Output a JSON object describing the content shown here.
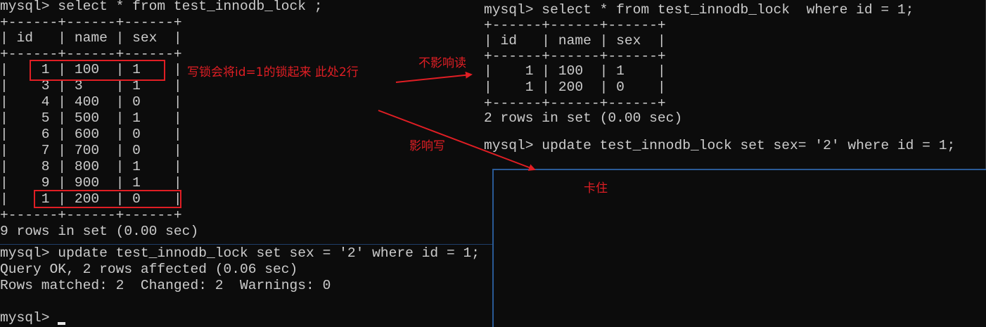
{
  "left_terminal": {
    "lines": [
      "mysql> select * from test_innodb_lock ;",
      "+------+------+------+",
      "| id   | name | sex  |",
      "+------+------+------+",
      "|    1 | 100  | 1    |",
      "|    3 | 3    | 1    |",
      "|    4 | 400  | 0    |",
      "|    5 | 500  | 1    |",
      "|    6 | 600  | 0    |",
      "|    7 | 700  | 0    |",
      "|    8 | 800  | 1    |",
      "|    9 | 900  | 1    |",
      "|    1 | 200  | 0    |",
      "+------+------+------+",
      "9 rows in set (0.00 sec)"
    ],
    "bottom_lines": [
      "mysql> update test_innodb_lock set sex = '2' where id = 1;",
      "Query OK, 2 rows affected (0.06 sec)",
      "Rows matched: 2  Changed: 2  Warnings: 0",
      ""
    ],
    "prompt": "mysql> "
  },
  "right_terminal": {
    "lines": [
      "mysql> select * from test_innodb_lock  where id = 1;",
      "+------+------+------+",
      "| id   | name | sex  |",
      "+------+------+------+",
      "|    1 | 100  | 1    |",
      "|    1 | 200  | 0    |",
      "+------+------+------+",
      "2 rows in set (0.00 sec)",
      "",
      "mysql> update test_innodb_lock set sex= '2' where id = 1;"
    ]
  },
  "annotations": {
    "lock_note": "写锁会将id=1的锁起来 此处2行",
    "no_read_effect": "不影响读",
    "write_effect": "影响写",
    "blocked": "卡住"
  },
  "colors": {
    "annotation": "#e01e24",
    "terminal_bg": "#0c0c0c",
    "terminal_text": "#cccccc"
  }
}
